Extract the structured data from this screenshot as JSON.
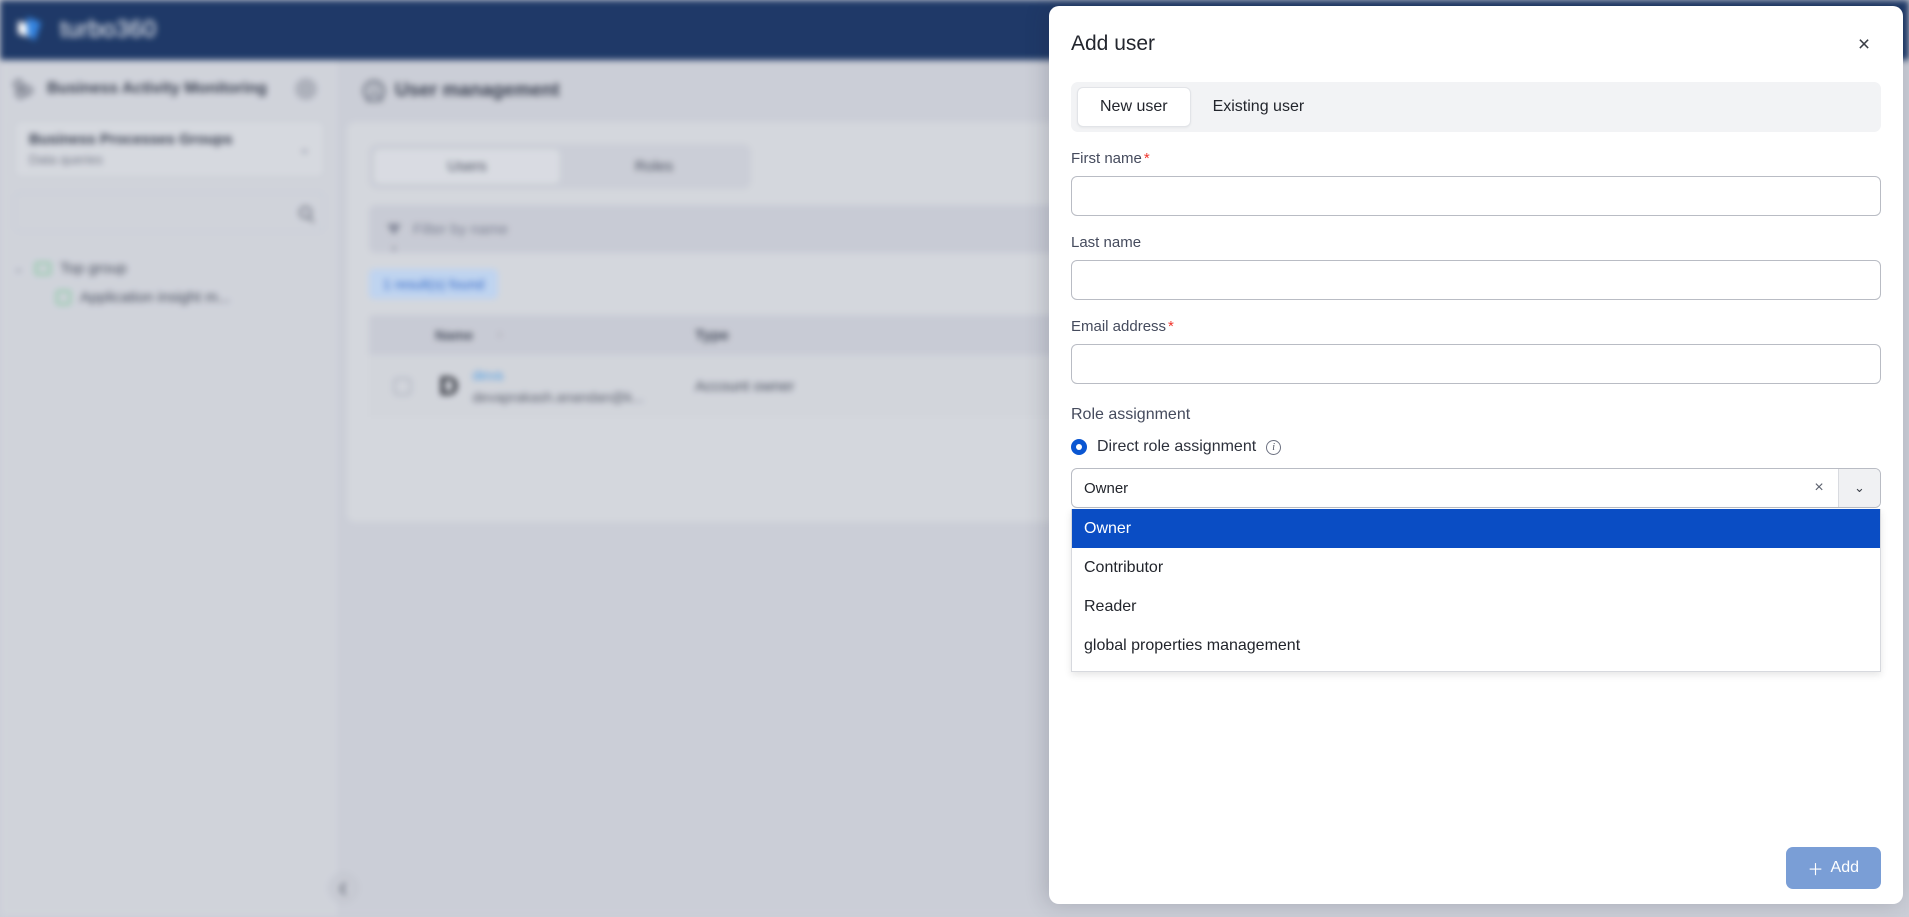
{
  "app": {
    "brand": "turbo360",
    "logo_icon": "turbo360-logo-icon"
  },
  "sidebar": {
    "header_title": "Business Activity Monitoring",
    "header_icon": "bam-nodes-icon",
    "avatar_icon": "user-avatar",
    "selector": {
      "primary": "Business Processes Groups",
      "secondary": "Data queries",
      "chevron": "⌄"
    },
    "search_icon": "search-icon",
    "tree": [
      {
        "label": "Top group",
        "icon": "folder-icon",
        "caret": "⌄",
        "level": 0
      },
      {
        "label": "Application insight m...",
        "icon": "process-icon",
        "caret": "",
        "level": 1
      }
    ],
    "collapse_icon": "❮"
  },
  "content": {
    "page_icon": "user-management-icon",
    "page_title": "User management",
    "segmented": {
      "options": [
        "Users",
        "Roles"
      ],
      "active": "Users"
    },
    "filter": {
      "icon": "funnel-icon",
      "placeholder": "Filter by name"
    },
    "results_badge": "1 result(s) found",
    "table": {
      "columns": [
        "",
        "Name",
        "Type"
      ],
      "sort_caret": "↑",
      "rows": [
        {
          "avatar_letter": "D",
          "name": "deva",
          "email": "devaprakash.anandan@k...",
          "type": "Account owner"
        }
      ]
    }
  },
  "modal": {
    "title": "Add user",
    "close_icon": "×",
    "tabs": [
      {
        "label": "New user",
        "active": true
      },
      {
        "label": "Existing user",
        "active": false
      }
    ],
    "fields": [
      {
        "label": "First name",
        "required": true,
        "value": "",
        "placeholder": ""
      },
      {
        "label": "Last name",
        "required": false,
        "value": "",
        "placeholder": ""
      },
      {
        "label": "Email address",
        "required": true,
        "value": "",
        "placeholder": ""
      }
    ],
    "role_section": {
      "label": "Role assignment",
      "radio_label": "Direct role assignment",
      "radio_selected": true,
      "info_icon": "info-icon",
      "combo": {
        "value": "Owner",
        "clear_icon": "×",
        "chevron_icon": "⌄",
        "options": [
          {
            "label": "Owner",
            "selected": true
          },
          {
            "label": "Contributor",
            "selected": false
          },
          {
            "label": "Reader",
            "selected": false
          },
          {
            "label": "global properties management",
            "selected": false
          }
        ]
      }
    },
    "footer": {
      "add_label": "Add",
      "add_icon": "＋"
    }
  },
  "colors": {
    "navbar": "#132f60",
    "page_bg": "#c9ccd5",
    "accent_blue": "#0a4dc4",
    "radio_blue": "#0a56d2",
    "add_button": "#7a9ed6",
    "required_red": "#f0352c",
    "badge_bg": "#bcd2f0",
    "badge_text": "#2a63c4",
    "link_blue": "#4397e3",
    "tree_green": "#7bc59a"
  }
}
